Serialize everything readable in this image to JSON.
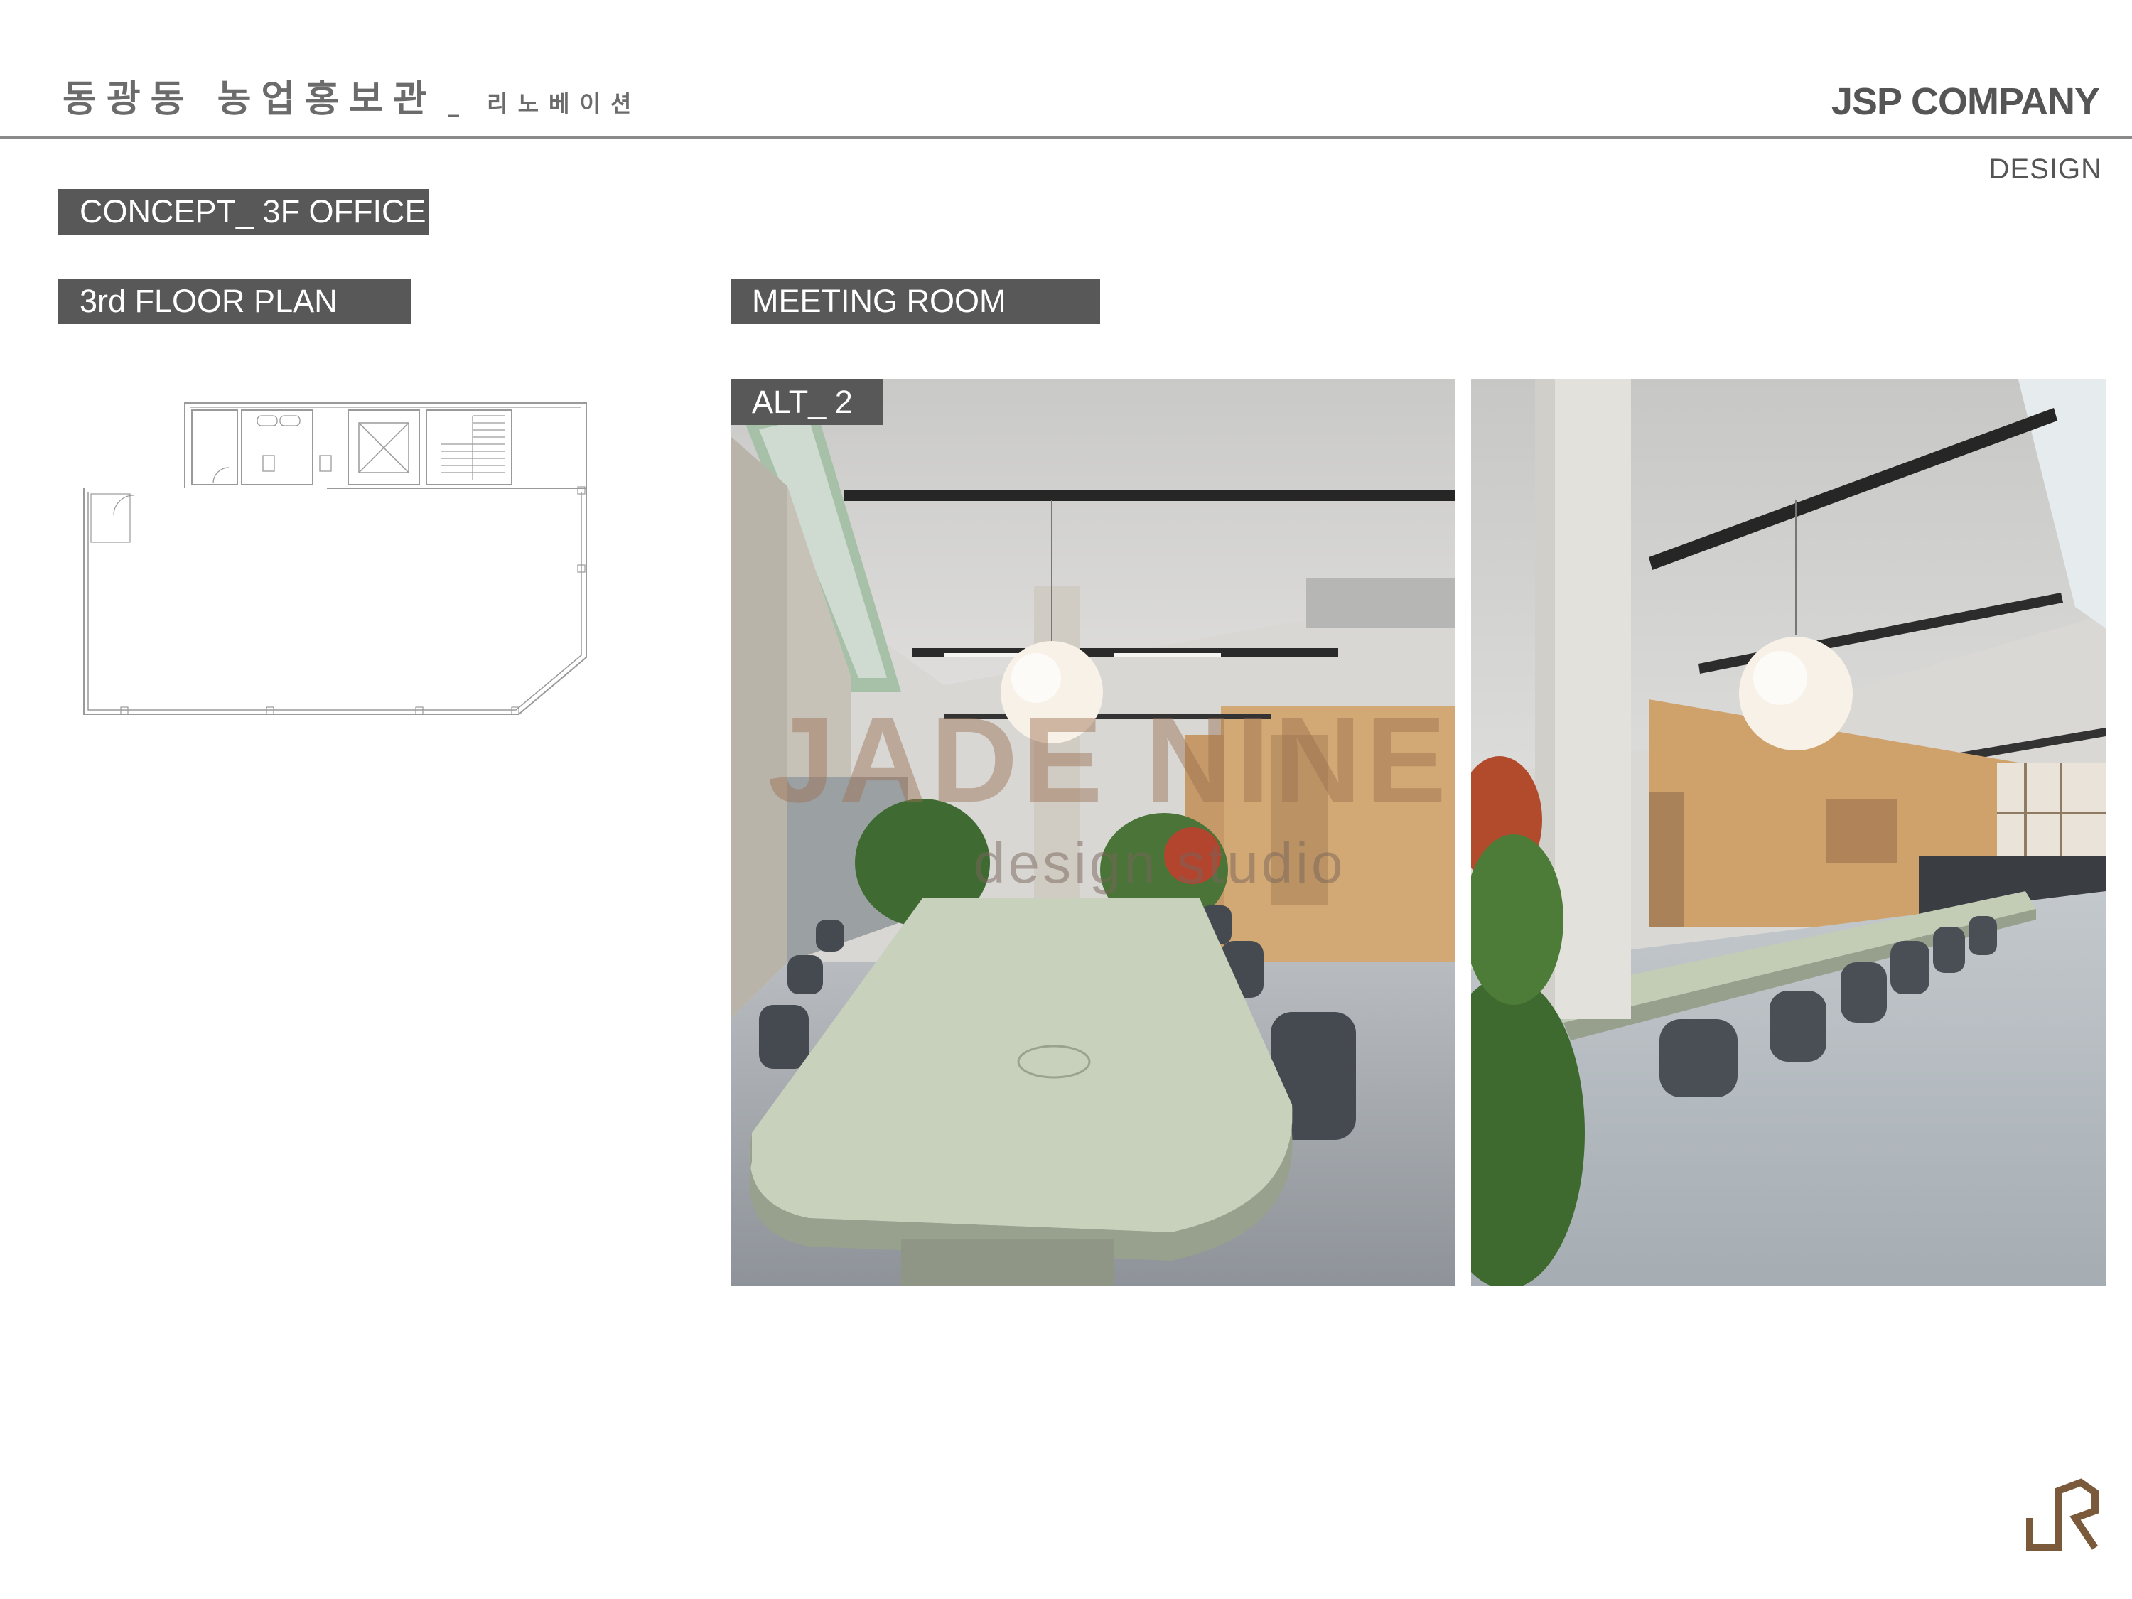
{
  "header": {
    "title_main": "동광동 농업홍보관",
    "title_sub": "_ 리노베이션",
    "company": "JSP COMPANY",
    "section": "DESIGN"
  },
  "labels": {
    "concept": "CONCEPT_ 3F OFFICE",
    "floor_plan": "3rd FLOOR PLAN",
    "meeting_room": "MEETING ROOM",
    "alt": "ALT_ 2"
  },
  "watermark": {
    "primary": "JADE NINE",
    "secondary": "design studio"
  },
  "icons": {
    "brand_logo": "jsp-monogram-icon"
  },
  "colors": {
    "label_bg": "#585858",
    "logo": "#7a5a3a",
    "table": "#c9d4be"
  }
}
